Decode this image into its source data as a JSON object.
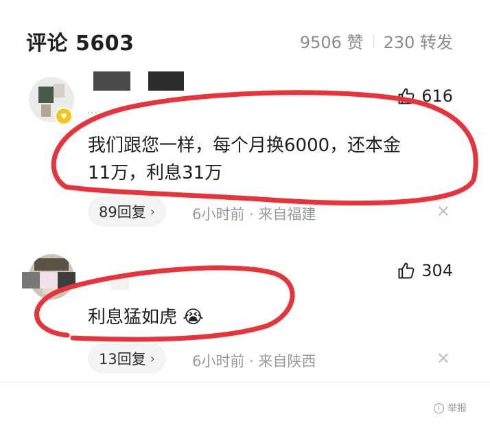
{
  "header": {
    "title": "评论 5603",
    "likes": "9506 赞",
    "reposts": "230 转发"
  },
  "comments": [
    {
      "subtitle": "...",
      "likes": "616",
      "text_line1": "我们跟您一样，每个月换6000，还本金",
      "text_line2": "11万，利息31万",
      "replies": "89回复",
      "time": "6小时前",
      "location": "来自福建"
    },
    {
      "likes": "304",
      "text": "利息猛如虎",
      "emoji": "😭",
      "replies": "13回复",
      "time": "6小时前",
      "location": "来自陕西"
    }
  ],
  "footer": {
    "report": "举报"
  },
  "colors": {
    "annotation_red": "#e8333a",
    "badge_gold": "#f5c518"
  },
  "icons": [
    "thumbs-up-icon",
    "chevron-right-icon",
    "close-icon",
    "info-icon",
    "crying-emoji"
  ]
}
